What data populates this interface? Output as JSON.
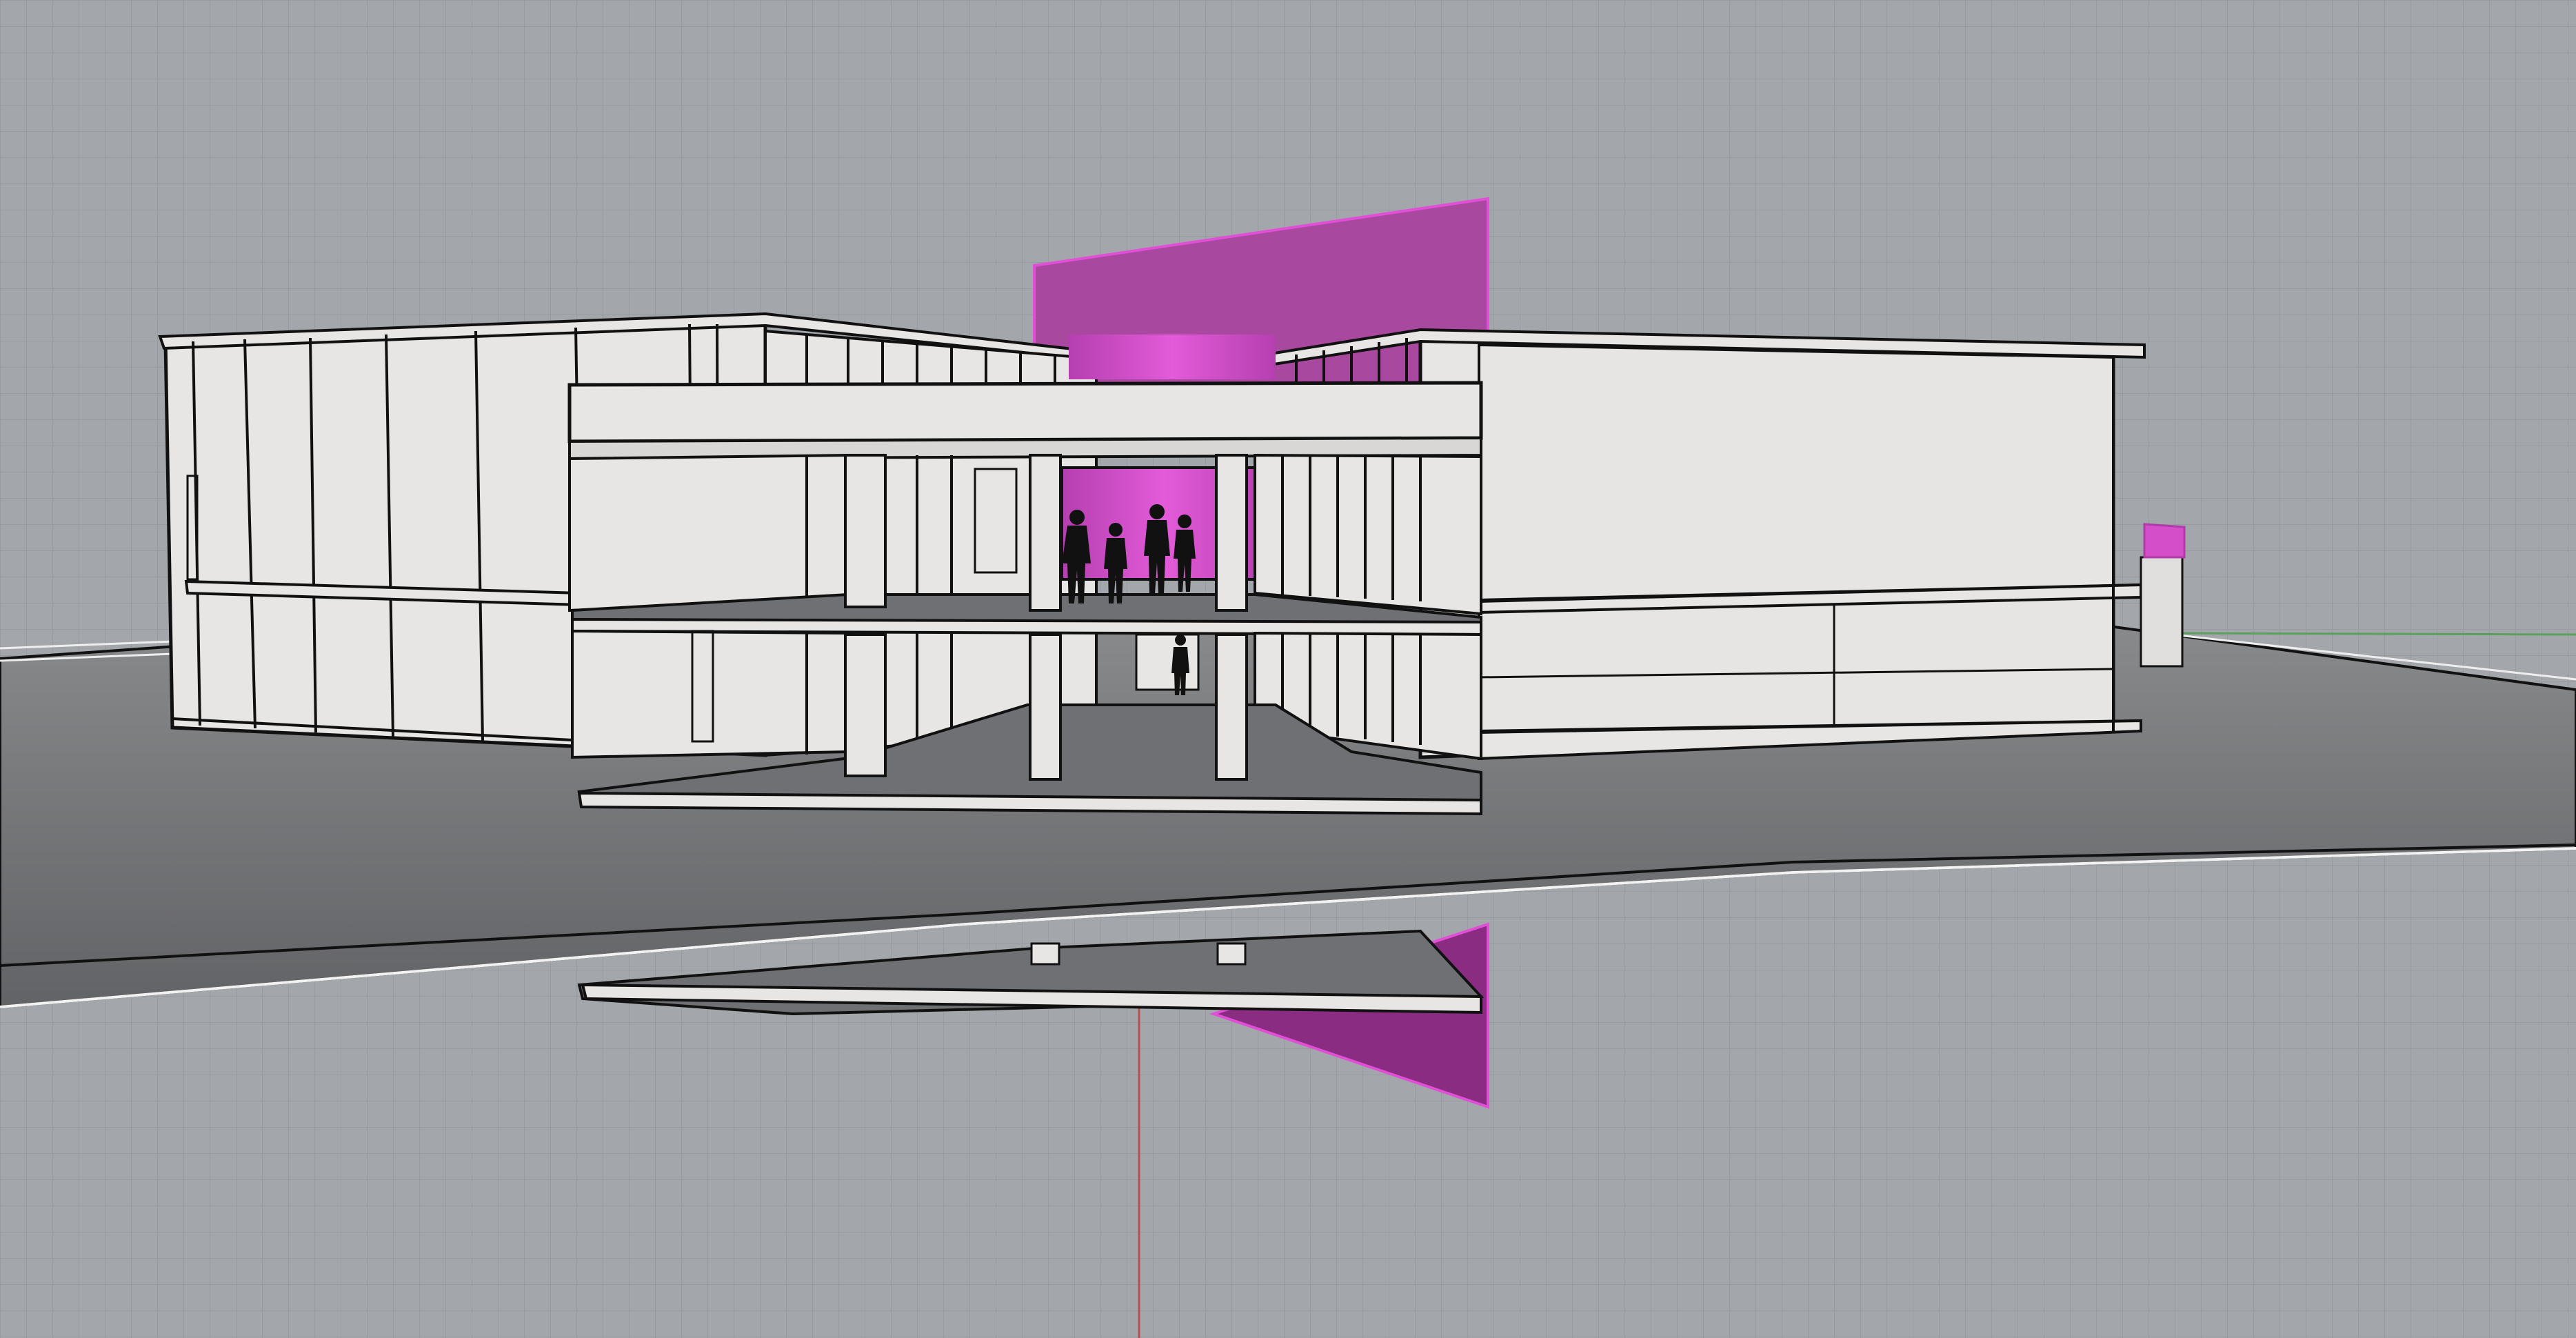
{
  "viewport": {
    "label": "",
    "view_type": "perspective",
    "display_mode": "pen"
  },
  "scene": {
    "background_color": "#a3a7ab",
    "grid_minor_color": "#9a9ea2",
    "grid_major_color": "#8f9397",
    "ground_color": "#6b6c6f",
    "ground_top_color": "#838486",
    "wall_color": "#e7e6e4",
    "wall_shade_color": "#d4d3d1",
    "edge_color": "#101010",
    "section_plane_color": "#d04ec6",
    "section_plane_dark": "#8a2c82",
    "x_axis_color": "#b9504e",
    "y_axis_color": "#58a05a",
    "people_count": 5
  }
}
